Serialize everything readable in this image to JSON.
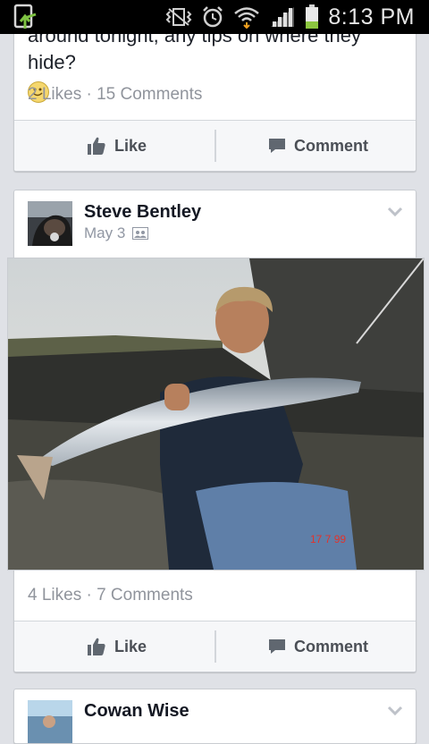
{
  "status_bar": {
    "time": "8:13 PM",
    "battery_level": 0.3,
    "icons": [
      "upload-icon",
      "vibrate-icon",
      "alarm-icon",
      "wifi-icon",
      "signal-icon",
      "battery-icon"
    ]
  },
  "posts": [
    {
      "text": "around tonight, any tips on where they hide?",
      "emoji": "smiley-emoji",
      "counts": "2 Likes · 15 Comments",
      "like_label": "Like",
      "comment_label": "Comment"
    },
    {
      "author": "Steve Bentley",
      "date": "May 3",
      "photo_stamp": "17  7 99",
      "counts": "4 Likes · 7 Comments",
      "like_label": "Like",
      "comment_label": "Comment"
    },
    {
      "author": "Cowan Wise"
    }
  ],
  "colors": {
    "background": "#dfe1e6",
    "card": "#ffffff",
    "muted_text": "#90949c",
    "action_text": "#4b4f56",
    "battery_green": "#8cc63f"
  }
}
